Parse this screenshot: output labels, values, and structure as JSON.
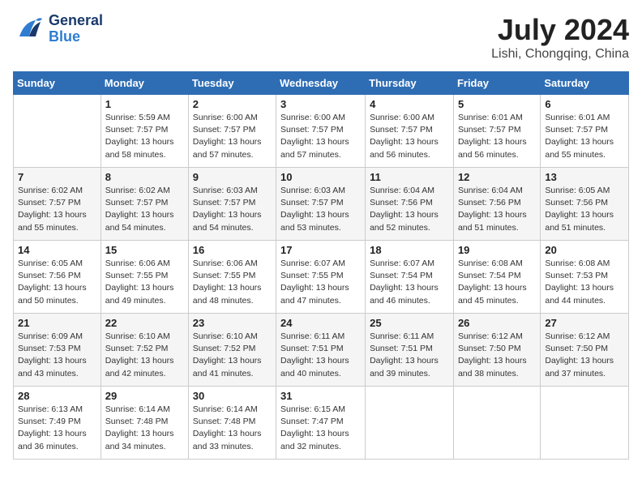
{
  "header": {
    "logo_general": "General",
    "logo_blue": "Blue",
    "month_year": "July 2024",
    "location": "Lishi, Chongqing, China"
  },
  "weekdays": [
    "Sunday",
    "Monday",
    "Tuesday",
    "Wednesday",
    "Thursday",
    "Friday",
    "Saturday"
  ],
  "weeks": [
    [
      {
        "day": "",
        "sunrise": "",
        "sunset": "",
        "daylight": ""
      },
      {
        "day": "1",
        "sunrise": "Sunrise: 5:59 AM",
        "sunset": "Sunset: 7:57 PM",
        "daylight": "Daylight: 13 hours and 58 minutes."
      },
      {
        "day": "2",
        "sunrise": "Sunrise: 6:00 AM",
        "sunset": "Sunset: 7:57 PM",
        "daylight": "Daylight: 13 hours and 57 minutes."
      },
      {
        "day": "3",
        "sunrise": "Sunrise: 6:00 AM",
        "sunset": "Sunset: 7:57 PM",
        "daylight": "Daylight: 13 hours and 57 minutes."
      },
      {
        "day": "4",
        "sunrise": "Sunrise: 6:00 AM",
        "sunset": "Sunset: 7:57 PM",
        "daylight": "Daylight: 13 hours and 56 minutes."
      },
      {
        "day": "5",
        "sunrise": "Sunrise: 6:01 AM",
        "sunset": "Sunset: 7:57 PM",
        "daylight": "Daylight: 13 hours and 56 minutes."
      },
      {
        "day": "6",
        "sunrise": "Sunrise: 6:01 AM",
        "sunset": "Sunset: 7:57 PM",
        "daylight": "Daylight: 13 hours and 55 minutes."
      }
    ],
    [
      {
        "day": "7",
        "sunrise": "Sunrise: 6:02 AM",
        "sunset": "Sunset: 7:57 PM",
        "daylight": "Daylight: 13 hours and 55 minutes."
      },
      {
        "day": "8",
        "sunrise": "Sunrise: 6:02 AM",
        "sunset": "Sunset: 7:57 PM",
        "daylight": "Daylight: 13 hours and 54 minutes."
      },
      {
        "day": "9",
        "sunrise": "Sunrise: 6:03 AM",
        "sunset": "Sunset: 7:57 PM",
        "daylight": "Daylight: 13 hours and 54 minutes."
      },
      {
        "day": "10",
        "sunrise": "Sunrise: 6:03 AM",
        "sunset": "Sunset: 7:57 PM",
        "daylight": "Daylight: 13 hours and 53 minutes."
      },
      {
        "day": "11",
        "sunrise": "Sunrise: 6:04 AM",
        "sunset": "Sunset: 7:56 PM",
        "daylight": "Daylight: 13 hours and 52 minutes."
      },
      {
        "day": "12",
        "sunrise": "Sunrise: 6:04 AM",
        "sunset": "Sunset: 7:56 PM",
        "daylight": "Daylight: 13 hours and 51 minutes."
      },
      {
        "day": "13",
        "sunrise": "Sunrise: 6:05 AM",
        "sunset": "Sunset: 7:56 PM",
        "daylight": "Daylight: 13 hours and 51 minutes."
      }
    ],
    [
      {
        "day": "14",
        "sunrise": "Sunrise: 6:05 AM",
        "sunset": "Sunset: 7:56 PM",
        "daylight": "Daylight: 13 hours and 50 minutes."
      },
      {
        "day": "15",
        "sunrise": "Sunrise: 6:06 AM",
        "sunset": "Sunset: 7:55 PM",
        "daylight": "Daylight: 13 hours and 49 minutes."
      },
      {
        "day": "16",
        "sunrise": "Sunrise: 6:06 AM",
        "sunset": "Sunset: 7:55 PM",
        "daylight": "Daylight: 13 hours and 48 minutes."
      },
      {
        "day": "17",
        "sunrise": "Sunrise: 6:07 AM",
        "sunset": "Sunset: 7:55 PM",
        "daylight": "Daylight: 13 hours and 47 minutes."
      },
      {
        "day": "18",
        "sunrise": "Sunrise: 6:07 AM",
        "sunset": "Sunset: 7:54 PM",
        "daylight": "Daylight: 13 hours and 46 minutes."
      },
      {
        "day": "19",
        "sunrise": "Sunrise: 6:08 AM",
        "sunset": "Sunset: 7:54 PM",
        "daylight": "Daylight: 13 hours and 45 minutes."
      },
      {
        "day": "20",
        "sunrise": "Sunrise: 6:08 AM",
        "sunset": "Sunset: 7:53 PM",
        "daylight": "Daylight: 13 hours and 44 minutes."
      }
    ],
    [
      {
        "day": "21",
        "sunrise": "Sunrise: 6:09 AM",
        "sunset": "Sunset: 7:53 PM",
        "daylight": "Daylight: 13 hours and 43 minutes."
      },
      {
        "day": "22",
        "sunrise": "Sunrise: 6:10 AM",
        "sunset": "Sunset: 7:52 PM",
        "daylight": "Daylight: 13 hours and 42 minutes."
      },
      {
        "day": "23",
        "sunrise": "Sunrise: 6:10 AM",
        "sunset": "Sunset: 7:52 PM",
        "daylight": "Daylight: 13 hours and 41 minutes."
      },
      {
        "day": "24",
        "sunrise": "Sunrise: 6:11 AM",
        "sunset": "Sunset: 7:51 PM",
        "daylight": "Daylight: 13 hours and 40 minutes."
      },
      {
        "day": "25",
        "sunrise": "Sunrise: 6:11 AM",
        "sunset": "Sunset: 7:51 PM",
        "daylight": "Daylight: 13 hours and 39 minutes."
      },
      {
        "day": "26",
        "sunrise": "Sunrise: 6:12 AM",
        "sunset": "Sunset: 7:50 PM",
        "daylight": "Daylight: 13 hours and 38 minutes."
      },
      {
        "day": "27",
        "sunrise": "Sunrise: 6:12 AM",
        "sunset": "Sunset: 7:50 PM",
        "daylight": "Daylight: 13 hours and 37 minutes."
      }
    ],
    [
      {
        "day": "28",
        "sunrise": "Sunrise: 6:13 AM",
        "sunset": "Sunset: 7:49 PM",
        "daylight": "Daylight: 13 hours and 36 minutes."
      },
      {
        "day": "29",
        "sunrise": "Sunrise: 6:14 AM",
        "sunset": "Sunset: 7:48 PM",
        "daylight": "Daylight: 13 hours and 34 minutes."
      },
      {
        "day": "30",
        "sunrise": "Sunrise: 6:14 AM",
        "sunset": "Sunset: 7:48 PM",
        "daylight": "Daylight: 13 hours and 33 minutes."
      },
      {
        "day": "31",
        "sunrise": "Sunrise: 6:15 AM",
        "sunset": "Sunset: 7:47 PM",
        "daylight": "Daylight: 13 hours and 32 minutes."
      },
      {
        "day": "",
        "sunrise": "",
        "sunset": "",
        "daylight": ""
      },
      {
        "day": "",
        "sunrise": "",
        "sunset": "",
        "daylight": ""
      },
      {
        "day": "",
        "sunrise": "",
        "sunset": "",
        "daylight": ""
      }
    ]
  ]
}
